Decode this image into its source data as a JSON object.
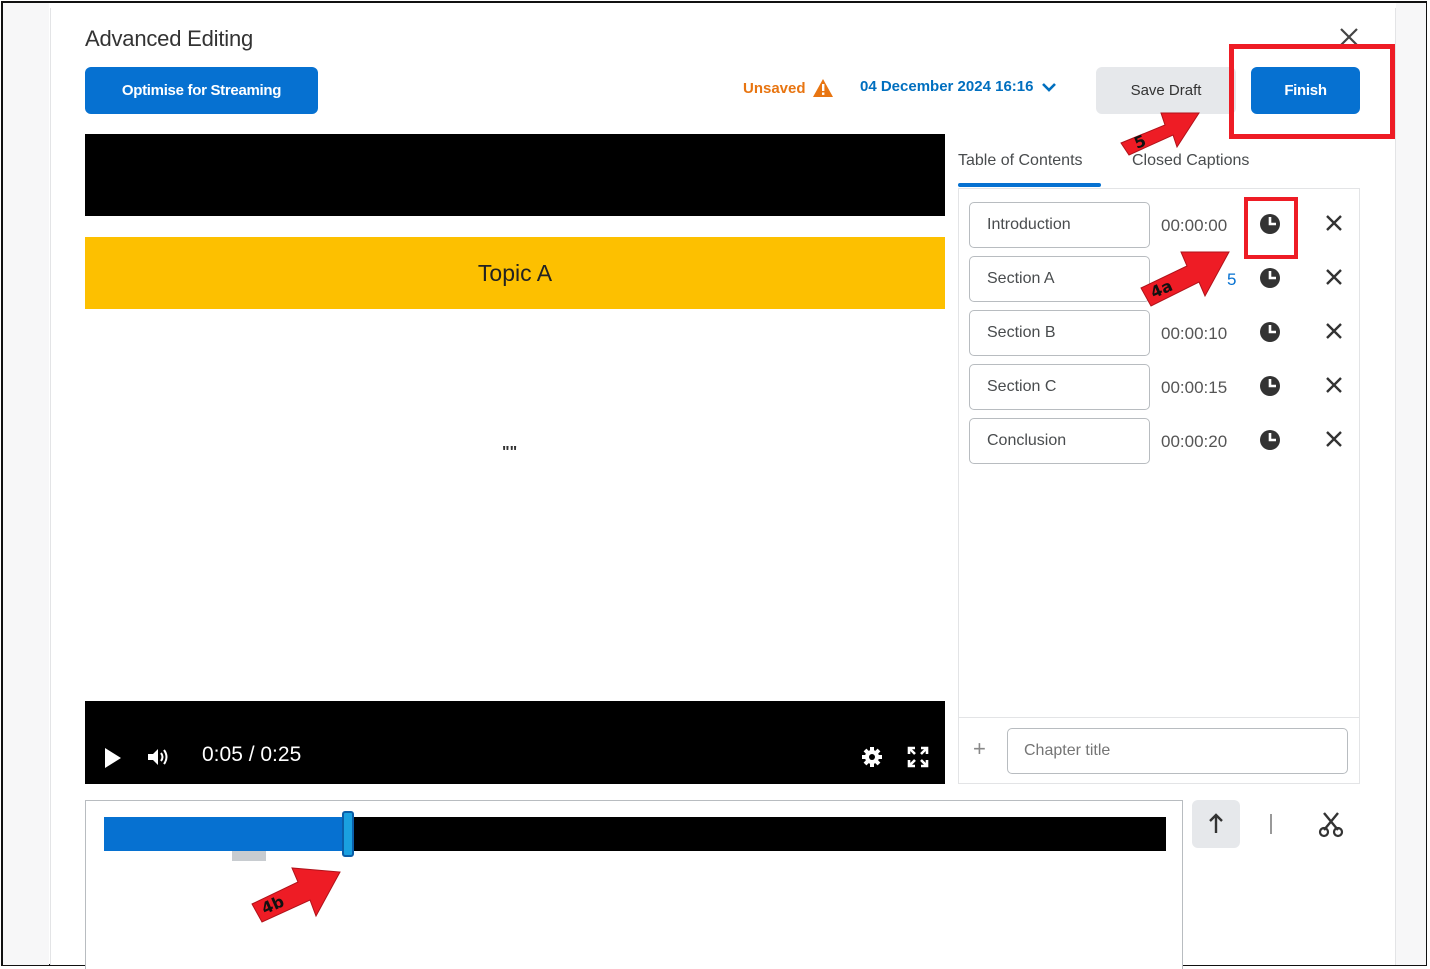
{
  "dialog": {
    "title": "Advanced Editing",
    "close_icon": "close-icon"
  },
  "toolbar": {
    "optimise_label": "Optimise for Streaming",
    "unsaved_label": "Unsaved",
    "date_label": "04 December 2024 16:16",
    "save_draft_label": "Save Draft",
    "finish_label": "Finish"
  },
  "video": {
    "topic_text": "Topic A",
    "center_mark": "\"\"",
    "time_display": "0:05 / 0:25",
    "progress": 0.2
  },
  "tabs": [
    {
      "label": "Table of Contents",
      "active": true
    },
    {
      "label": "Closed Captions",
      "active": false
    }
  ],
  "chapters": [
    {
      "title": "Introduction",
      "time": "00:00:00"
    },
    {
      "title": "Section A",
      "time": "5"
    },
    {
      "title": "Section B",
      "time": "00:00:10"
    },
    {
      "title": "Section C",
      "time": "00:00:15"
    },
    {
      "title": "Conclusion",
      "time": "00:00:20"
    }
  ],
  "add_chapter": {
    "placeholder": "Chapter title"
  },
  "timeline": {
    "progress": 0.23
  },
  "annotations": {
    "arrow_5": "5",
    "arrow_4a": "4a",
    "arrow_4b": "4b"
  },
  "colors": {
    "primary": "#0671d1",
    "warning": "#e87511",
    "topic_bar": "#fdc000",
    "highlight": "#ee1c25"
  }
}
